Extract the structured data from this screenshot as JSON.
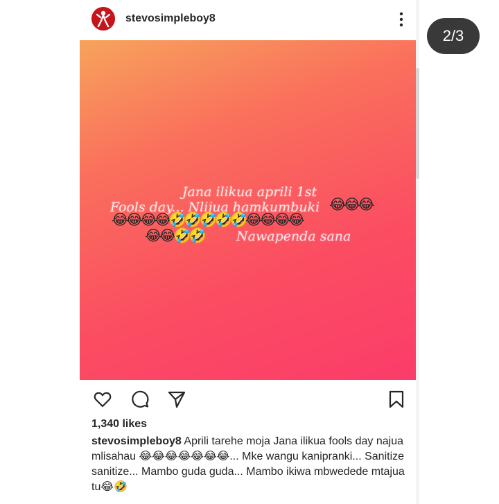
{
  "post": {
    "username": "stevosimpleboy8",
    "image_text": {
      "line1": "Jana ilikua aprili 1st",
      "line2": "Fools day... Nlijua hamkumbuki",
      "emojis_a": "😂😂😂",
      "emojis_b": "😂😂😂😂🤣🤣🤣🤣🤣😂😂😂😂",
      "emojis_c": "😂😂🤣🤣",
      "line3": "Nawapenda sana"
    },
    "likes": "1,340 likes",
    "caption_user": "stevosimpleboy8",
    "caption_text": " Aprili tarehe moja Jana ilikua fools day najua mlisahau 😂😂😂😂😂😂😂... Mke wangu kanipranki... Sanitize sanitize... Mambo guda guda... Mambo ikiwa mbwedede mtajua tu😂🤣"
  },
  "pager": {
    "label": "2/3"
  },
  "icons": {
    "avatar": "profile-avatar",
    "more": "three-dots-vertical-icon",
    "like": "heart-icon",
    "comment": "comment-bubble-icon",
    "share": "paper-plane-icon",
    "save": "bookmark-icon"
  },
  "colors": {
    "gradient_top": "#f7a35c",
    "gradient_bottom": "#fb3c6a",
    "pager_bg": "#282828"
  }
}
